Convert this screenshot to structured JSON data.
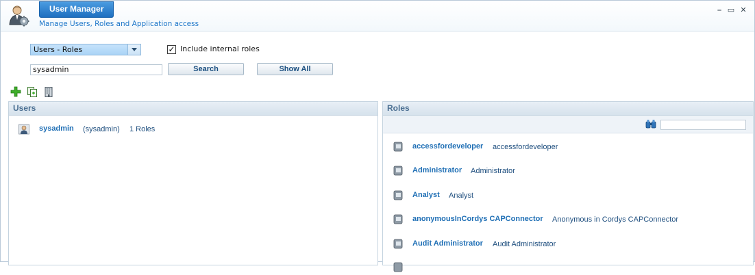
{
  "app": {
    "title": "User Manager",
    "subtitle": "Manage Users, Roles and Application access",
    "icon": "user-manager-icon"
  },
  "window_controls": {
    "minimize": "–",
    "maximize": "▭",
    "close": "✕"
  },
  "filter": {
    "view_select": "Users - Roles",
    "include_internal_label": "Include internal roles",
    "include_internal_checked": true,
    "search_value": "sysadmin",
    "search_button": "Search",
    "show_all_button": "Show All"
  },
  "toolbar": {
    "icons": [
      "add-icon",
      "copy-icon",
      "building-icon"
    ]
  },
  "users_panel": {
    "title": "Users",
    "items": [
      {
        "name": "sysadmin",
        "id": "(sysadmin)",
        "roles": "1 Roles"
      }
    ]
  },
  "roles_panel": {
    "title": "Roles",
    "filter_placeholder": "",
    "items": [
      {
        "name": "accessfordeveloper",
        "desc": "accessfordeveloper"
      },
      {
        "name": "Administrator",
        "desc": "Administrator"
      },
      {
        "name": "Analyst",
        "desc": "Analyst"
      },
      {
        "name": "anonymousInCordys CAPConnector",
        "desc": "Anonymous in Cordys CAPConnector"
      },
      {
        "name": "Audit Administrator",
        "desc": "Audit Administrator"
      }
    ]
  },
  "colors": {
    "accent": "#1e6fc0",
    "link": "#1f6fb5",
    "panel_header_text": "#4b6f92"
  }
}
